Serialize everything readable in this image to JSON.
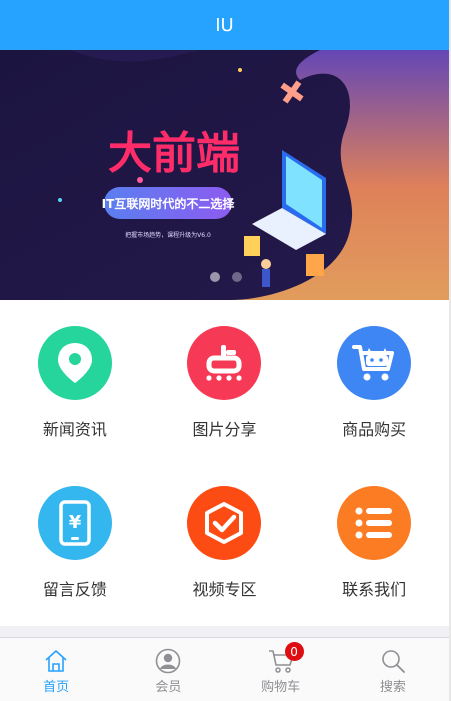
{
  "header": {
    "title": "IU"
  },
  "banner": {
    "headline": "大前端",
    "slogan": "IT互联网时代的不二选择",
    "subtext": "把握市场趋势，课程升级为V6.0",
    "slides": 2,
    "active_slide": 1
  },
  "grid": {
    "items": [
      {
        "label": "新闻资讯",
        "icon": "map-pin-icon",
        "color": "#26d59b"
      },
      {
        "label": "图片分享",
        "icon": "dian-icon",
        "color": "#f63a56"
      },
      {
        "label": "商品购买",
        "icon": "shopping-cart-icon",
        "color": "#3e86f3"
      },
      {
        "label": "留言反馈",
        "icon": "phone-yuan-icon",
        "color": "#33b7ee"
      },
      {
        "label": "视频专区",
        "icon": "check-shield-icon",
        "color": "#fc4b13"
      },
      {
        "label": "联系我们",
        "icon": "list-icon",
        "color": "#fb7c23"
      }
    ]
  },
  "tabbar": {
    "items": [
      {
        "label": "首页",
        "icon": "home-icon",
        "active": true
      },
      {
        "label": "会员",
        "icon": "user-icon",
        "active": false
      },
      {
        "label": "购物车",
        "icon": "cart-icon",
        "active": false,
        "badge": "0"
      },
      {
        "label": "搜索",
        "icon": "search-icon",
        "active": false
      }
    ]
  }
}
